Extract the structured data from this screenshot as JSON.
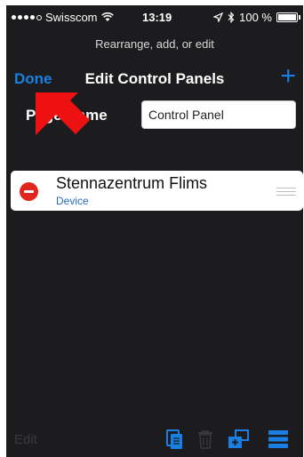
{
  "status_bar": {
    "carrier": "Swisscom",
    "time": "13:19",
    "battery": "100 %"
  },
  "header": {
    "subtitle": "Rearrange, add, or edit",
    "title": "Edit Control Panels",
    "done_label": "Done",
    "add_icon": "plus-icon"
  },
  "form": {
    "page_name_label": "Page Name",
    "page_name_value": "Control Panel"
  },
  "list": {
    "items": [
      {
        "title": "Stennazentrum Flims",
        "subtitle": "Device"
      }
    ]
  },
  "toolbar": {
    "edit_label": "Edit",
    "icons": [
      "copy-icon",
      "trash-icon",
      "add-page-icon",
      "list-icon"
    ]
  },
  "colors": {
    "accent": "#1a7fe3",
    "background": "#1c1c1f",
    "delete": "#e0261d",
    "annotation_arrow": "#ee1111"
  }
}
